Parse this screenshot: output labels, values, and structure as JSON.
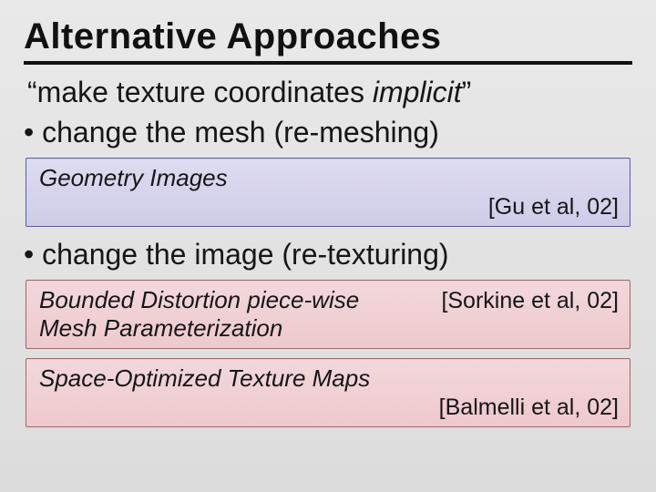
{
  "title": "Alternative Approaches",
  "quote": {
    "open": "“",
    "text": "make texture coordinates ",
    "em": "implicit",
    "close": "”"
  },
  "bullets": {
    "remesh": "change the mesh (re-meshing)",
    "retexture": "change the image (re-texturing)"
  },
  "cards": {
    "geom": {
      "name": "Geometry Images",
      "cite": "[Gu et al, 02]"
    },
    "bdpm": {
      "name": "Bounded Distortion piece-wise Mesh Parameterization",
      "cite": "[Sorkine et al, 02]"
    },
    "sotm": {
      "name": "Space-Optimized Texture Maps",
      "cite": "[Balmelli et al, 02]"
    }
  }
}
